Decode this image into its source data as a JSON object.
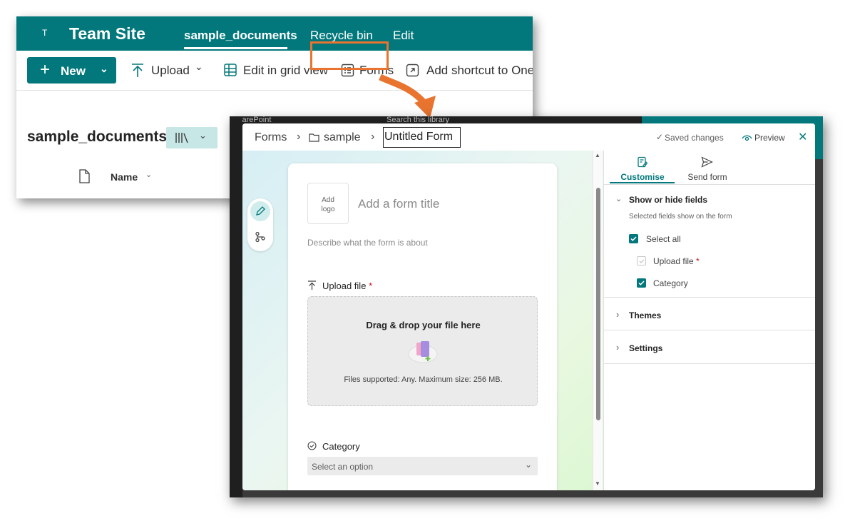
{
  "sharepoint": {
    "logo_letter": "T",
    "site_title": "Team Site",
    "nav": [
      "sample_documents",
      "Recycle bin",
      "Edit"
    ],
    "commands": {
      "new": "New",
      "upload": "Upload",
      "edit_grid": "Edit in grid view",
      "forms": "Forms",
      "add_shortcut": "Add shortcut to One"
    },
    "library_title": "sample_documents",
    "column_name": "Name",
    "behind_strip": {
      "brand": "SharePoint",
      "search": "Search this library"
    }
  },
  "forms": {
    "breadcrumb": [
      "Forms",
      "sample"
    ],
    "form_name": "Untitled Form",
    "saved": "Saved changes",
    "preview": "Preview",
    "card": {
      "logo": [
        "Add",
        "logo"
      ],
      "title_placeholder": "Add a form title",
      "desc_placeholder": "Describe what the form is about",
      "upload_label": "Upload file",
      "required_mark": "*",
      "dropzone_title": "Drag & drop your file here",
      "dropzone_sub": "Files supported: Any. Maximum size: 256 MB.",
      "category_label": "Category",
      "select_placeholder": "Select an option"
    },
    "side": {
      "tabs": [
        "Customise",
        "Send form"
      ],
      "show_hide_title": "Show or hide fields",
      "show_hide_help": "Selected fields show on the form",
      "select_all": "Select all",
      "field_upload": "Upload file",
      "field_category": "Category",
      "themes": "Themes",
      "settings": "Settings"
    }
  },
  "colors": {
    "teal": "#03787c",
    "callout": "#e8742f",
    "required": "#c50f1f"
  },
  "icons": [
    "plus-icon",
    "chevron-down-icon",
    "upload-icon",
    "grid-icon",
    "forms-icon",
    "shortcut-icon",
    "library-view-icon",
    "file-icon",
    "folder-icon",
    "chevron-right-icon",
    "check-icon",
    "eye-icon",
    "close-icon",
    "pen-icon",
    "branch-icon",
    "customise-icon",
    "send-icon",
    "check-circle-icon",
    "cloud-upload-icon"
  ]
}
